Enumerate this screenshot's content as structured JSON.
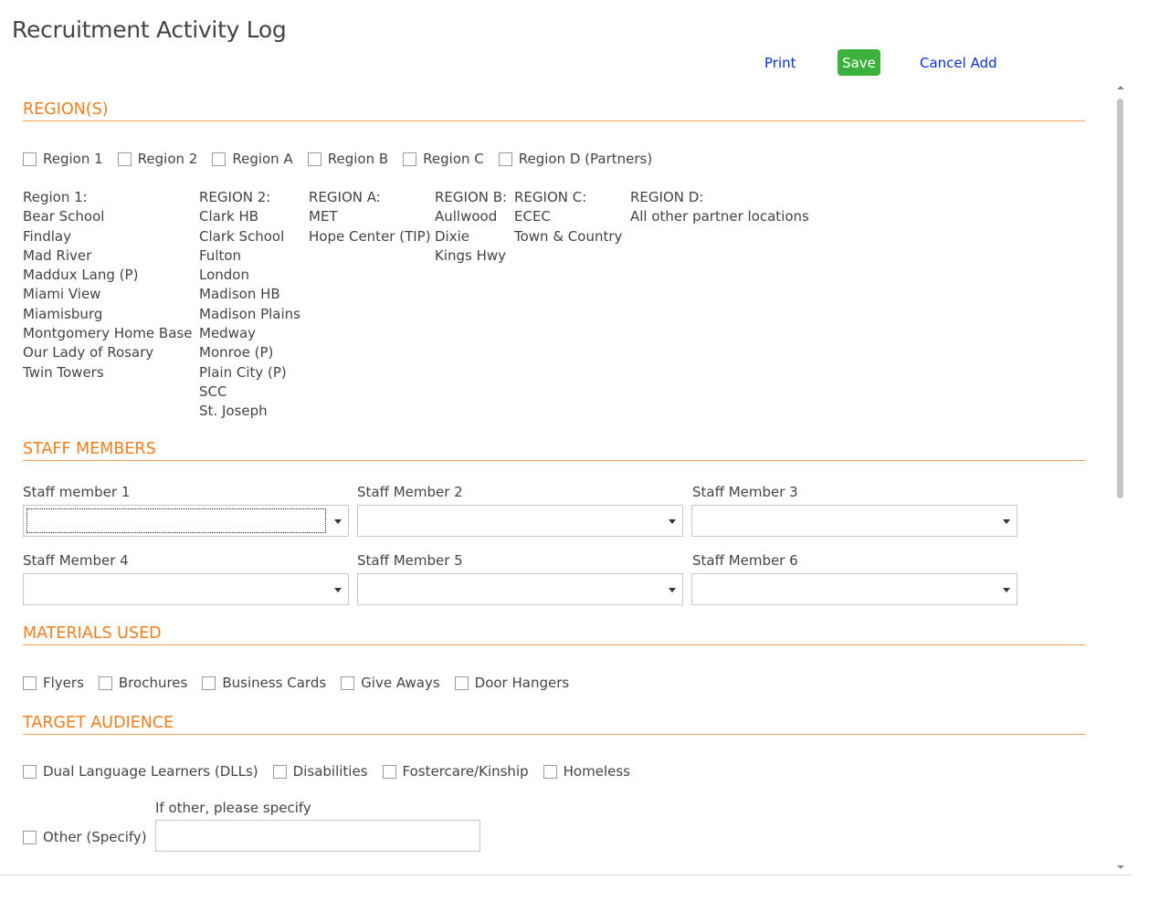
{
  "title": "Recruitment Activity Log",
  "toolbar": {
    "print_label": "Print",
    "save_label": "Save",
    "cancel_label": "Cancel Add"
  },
  "sections": {
    "regions": {
      "header": "REGION(S)",
      "checkboxes": [
        "Region 1",
        "Region 2",
        "Region A",
        "Region B",
        "Region C",
        "Region D (Partners)"
      ],
      "columns": [
        {
          "heading": "Region 1:",
          "items": [
            "Bear School",
            "Findlay",
            "Mad River",
            "Maddux Lang (P)",
            "Miami View",
            "Miamisburg",
            "Montgomery Home Base",
            "Our Lady of Rosary",
            "Twin Towers"
          ]
        },
        {
          "heading": "REGION 2:",
          "items": [
            "Clark HB",
            "Clark School",
            "Fulton",
            "London",
            "Madison HB",
            "Madison Plains",
            "Medway",
            "Monroe (P)",
            "Plain City (P)",
            "SCC",
            "St. Joseph"
          ]
        },
        {
          "heading": "REGION A:",
          "items": [
            "MET",
            "Hope Center (TIP)"
          ]
        },
        {
          "heading": "REGION B:",
          "items": [
            "Aullwood",
            "Dixie",
            "Kings Hwy"
          ]
        },
        {
          "heading": "REGION C:",
          "items": [
            "ECEC",
            "Town & Country"
          ]
        },
        {
          "heading": "REGION D:",
          "items": [
            "All other partner locations"
          ]
        }
      ]
    },
    "staff": {
      "header": "STAFF MEMBERS",
      "fields": [
        {
          "label": "Staff member 1",
          "value": ""
        },
        {
          "label": "Staff Member 2",
          "value": ""
        },
        {
          "label": "Staff Member 3",
          "value": ""
        },
        {
          "label": "Staff Member 4",
          "value": ""
        },
        {
          "label": "Staff Member 5",
          "value": ""
        },
        {
          "label": "Staff Member 6",
          "value": ""
        }
      ]
    },
    "materials": {
      "header": "MATERIALS USED",
      "checkboxes": [
        "Flyers",
        "Brochures",
        "Business Cards",
        "Give Aways",
        "Door Hangers"
      ]
    },
    "audience": {
      "header": "TARGET AUDIENCE",
      "checkboxes": [
        "Dual Language Learners (DLLs)",
        "Disabilities",
        "Fostercare/Kinship",
        "Homeless"
      ],
      "other_label": "Other (Specify)",
      "other_field_label": "If other, please specify",
      "other_value": ""
    }
  },
  "colors": {
    "section_header": "#f07e1c",
    "link": "#0b2fd6",
    "save_button": "#3cb23c"
  }
}
